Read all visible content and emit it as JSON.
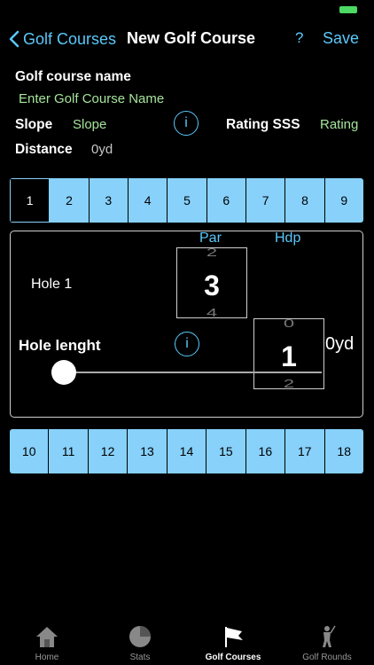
{
  "nav": {
    "back_label": "Golf Courses",
    "title": "New Golf Course",
    "help": "?",
    "save": "Save"
  },
  "form": {
    "name_label": "Golf course name",
    "name_placeholder": "Enter Golf Course Name",
    "slope_label": "Slope",
    "slope_placeholder": "Slope",
    "info1": "i",
    "rating_label": "Rating SSS",
    "rating_placeholder": "Rating",
    "distance_label": "Distance",
    "distance_value": "0yd"
  },
  "holes_front": [
    "1",
    "2",
    "3",
    "4",
    "5",
    "6",
    "7",
    "8",
    "9"
  ],
  "holes_back": [
    "10",
    "11",
    "12",
    "13",
    "14",
    "15",
    "16",
    "17",
    "18"
  ],
  "hole_panel": {
    "hole_label": "Hole 1",
    "par_label": "Par",
    "par_prev": "2",
    "par_value": "3",
    "par_next": "4",
    "hdp_label": "Hdp",
    "hdp_prev": "0",
    "hdp_value": "1",
    "hdp_next": "2",
    "length_label": "Hole lenght",
    "info": "i",
    "length_value": "0yd",
    "slider_fraction": 0
  },
  "tabs": [
    {
      "label": "Home",
      "icon": "home-icon"
    },
    {
      "label": "Stats",
      "icon": "stats-pie-icon"
    },
    {
      "label": "Golf Courses",
      "icon": "flag-icon"
    },
    {
      "label": "Golf Rounds",
      "icon": "golfer-icon"
    }
  ],
  "colors": {
    "accent": "#5ac8fa",
    "hole_bg": "#87d1fb",
    "placeholder_green": "#a5e39b",
    "battery": "#4cd964"
  }
}
